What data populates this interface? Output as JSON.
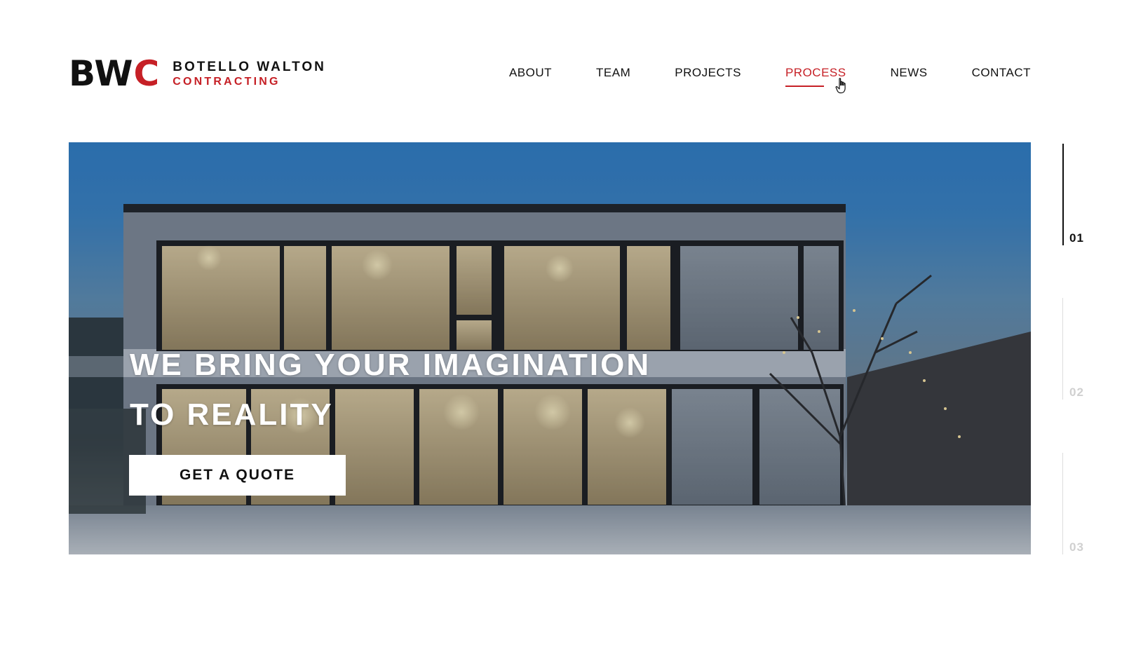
{
  "brand": {
    "mark_prefix": "BW",
    "mark_accent": "C",
    "line1": "BOTELLO WALTON",
    "line2": "CONTRACTING",
    "accent_color": "#c62026"
  },
  "nav": {
    "items": [
      {
        "label": "ABOUT",
        "active": false
      },
      {
        "label": "TEAM",
        "active": false
      },
      {
        "label": "PROJECTS",
        "active": false
      },
      {
        "label": "PROCESS",
        "active": true
      },
      {
        "label": "NEWS",
        "active": false
      },
      {
        "label": "CONTACT",
        "active": false
      }
    ]
  },
  "hero": {
    "title_line1": "WE BRING YOUR IMAGINATION",
    "title_line2": "TO REALITY",
    "cta_label": "GET A QUOTE",
    "image_icon": "modern-house-photo"
  },
  "slides": {
    "items": [
      "01",
      "02",
      "03"
    ],
    "active_index": 0
  }
}
